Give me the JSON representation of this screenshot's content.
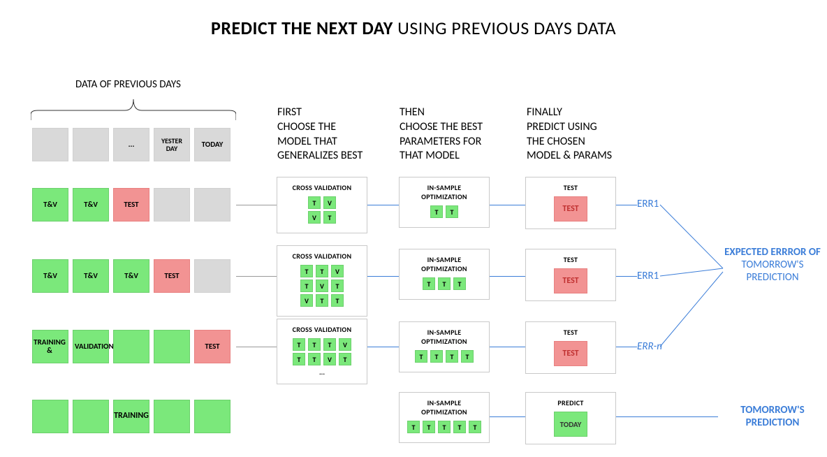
{
  "title_bold": "PREDICT THE NEXT DAY",
  "title_light": "USING PREVIOUS DAYS DATA",
  "section_label": "DATA OF PREVIOUS DAYS",
  "header_cells": {
    "dots": "...",
    "yesterday": "YESTER\nDAY",
    "today": "TODAY"
  },
  "columns": {
    "first": "FIRST\nCHOOSE THE\nMODEL THAT\nGENERALIZES BEST",
    "then": "THEN\nCHOOSE THE BEST\nPARAMETERS FOR\nTHAT MODEL",
    "finally": "FINALLY\nPREDICT USING\nTHE CHOSEN\nMODEL & PARAMS"
  },
  "rows": [
    {
      "cells": [
        {
          "t": "T&V",
          "c": "green"
        },
        {
          "t": "T&V",
          "c": "green"
        },
        {
          "t": "TEST",
          "c": "red"
        },
        {
          "t": "",
          "c": "gray"
        },
        {
          "t": "",
          "c": "gray"
        }
      ]
    },
    {
      "cells": [
        {
          "t": "T&V",
          "c": "green"
        },
        {
          "t": "T&V",
          "c": "green"
        },
        {
          "t": "T&V",
          "c": "green"
        },
        {
          "t": "TEST",
          "c": "red"
        },
        {
          "t": "",
          "c": "gray"
        }
      ]
    },
    {
      "cells": [
        {
          "t": "TRAINING &",
          "c": "green"
        },
        {
          "t": "VALIDATION",
          "c": "green"
        },
        {
          "t": "",
          "c": "green"
        },
        {
          "t": "",
          "c": "green"
        },
        {
          "t": "TEST",
          "c": "red"
        }
      ]
    },
    {
      "cells": [
        {
          "t": "",
          "c": "green"
        },
        {
          "t": "",
          "c": "green"
        },
        {
          "t": "TRAINING",
          "c": "green"
        },
        {
          "t": "",
          "c": "green"
        },
        {
          "t": "",
          "c": "green"
        }
      ]
    }
  ],
  "card_titles": {
    "cross": "CROSS VALIDATION",
    "insample": "IN-SAMPLE\nOPTIMIZATION",
    "test": "TEST",
    "predict": "PREDICT"
  },
  "cross_grids": [
    [
      [
        "T",
        "V"
      ],
      [
        "V",
        "T"
      ]
    ],
    [
      [
        "T",
        "T",
        "V"
      ],
      [
        "T",
        "V",
        "T"
      ],
      [
        "V",
        "T",
        "T"
      ]
    ],
    [
      [
        "T",
        "T",
        "T",
        "V"
      ],
      [
        "T",
        "T",
        "V",
        "T"
      ]
    ]
  ],
  "insample_grids": [
    [
      "T",
      "T"
    ],
    [
      "T",
      "T",
      "T"
    ],
    [
      "T",
      "T",
      "T",
      "T"
    ],
    [
      "T",
      "T",
      "T",
      "T",
      "T"
    ]
  ],
  "test_label": "TEST",
  "today_label": "TODAY",
  "err_labels": [
    "ERR1",
    "ERR1",
    "ERR-n"
  ],
  "right1_bold": "EXPECTED ERRROR OF",
  "right1_light": "TOMORROW'S PREDICTION",
  "right2_bold": "TOMORROW'S PREDICTION"
}
